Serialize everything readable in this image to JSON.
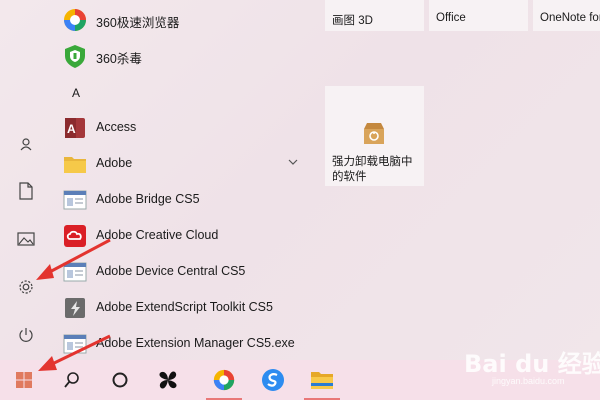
{
  "app_list": {
    "items": [
      {
        "label": "360极速浏览器",
        "icon": "360-browser-icon"
      },
      {
        "label": "360杀毒",
        "icon": "360-antivirus-icon"
      },
      {
        "label": "Access",
        "icon": "access-icon"
      },
      {
        "label": "Adobe",
        "icon": "folder-icon"
      },
      {
        "label": "Adobe Bridge CS5",
        "icon": "adobe-bridge-icon"
      },
      {
        "label": "Adobe Creative Cloud",
        "icon": "creative-cloud-icon"
      },
      {
        "label": "Adobe Device Central CS5",
        "icon": "device-central-icon"
      },
      {
        "label": "Adobe ExtendScript Toolkit CS5",
        "icon": "extendscript-icon"
      },
      {
        "label": "Adobe Extension Manager CS5.exe",
        "icon": "extension-manager-icon"
      }
    ],
    "section_letter": "A"
  },
  "tiles": {
    "paint3d": "画图 3D",
    "office": "Office",
    "onenote": "OneNote for",
    "uninstall_line1": "强力卸载电脑中",
    "uninstall_line2": "的软件"
  },
  "rail": {
    "icons": [
      "user-icon",
      "document-icon",
      "pictures-icon",
      "settings-icon",
      "power-icon"
    ]
  },
  "taskbar": {
    "items": [
      "start-icon",
      "search-icon",
      "cortana-icon",
      "pinwheel-app-icon",
      "360-browser-icon",
      "sogou-browser-icon",
      "file-explorer-icon"
    ]
  },
  "watermark": {
    "text": "Bai du 经验",
    "sub": "jingyan.baidu.com"
  },
  "colors": {
    "accent_red": "#e3342f",
    "taskbar_bg": "#f6e0e9",
    "tile_bg": "#f7f2f4"
  }
}
